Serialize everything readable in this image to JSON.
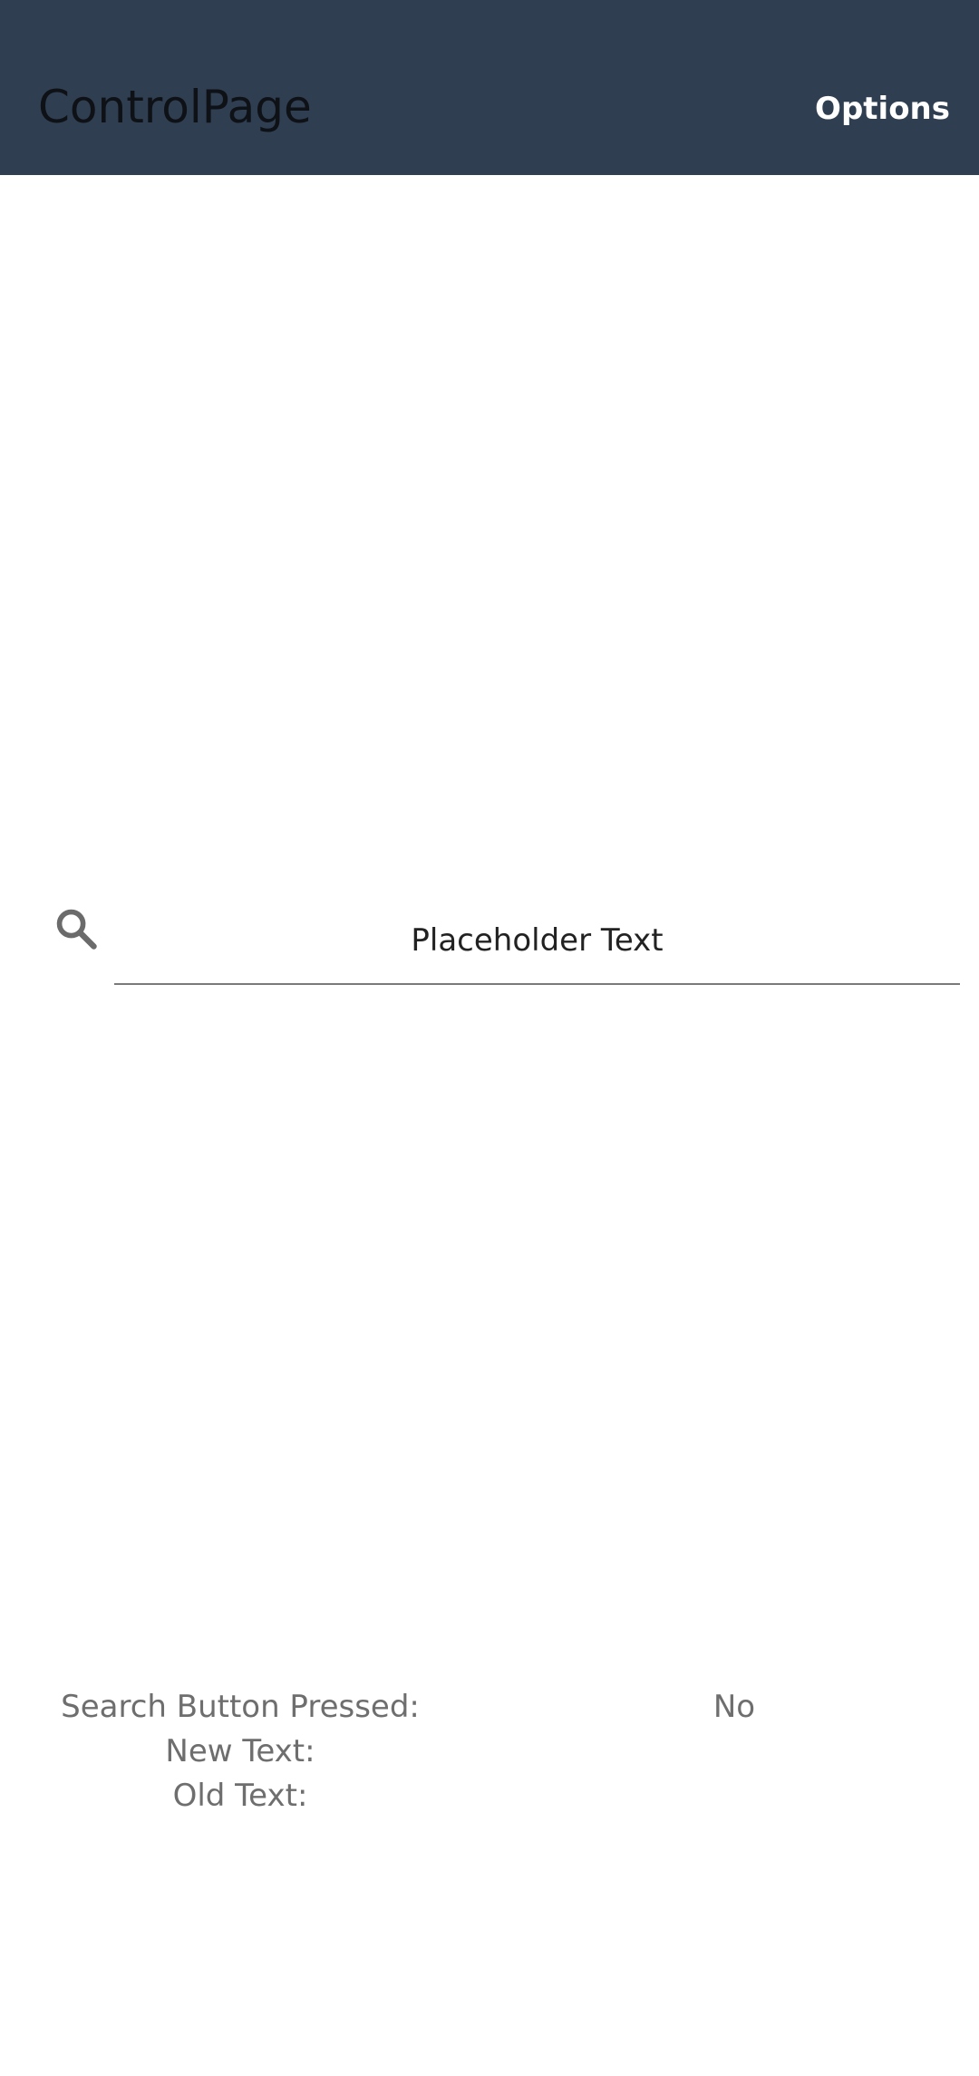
{
  "appbar": {
    "title": "ControlPage",
    "options_label": "Options",
    "background_color": "#2f3e51"
  },
  "search": {
    "icon": "search-icon",
    "placeholder": "Placeholder Text",
    "value": ""
  },
  "status": {
    "search_button_pressed_label": "Search Button Pressed:",
    "search_button_pressed_value": "No",
    "new_text_label": "New Text:",
    "new_text_value": "",
    "old_text_label": "Old Text:",
    "old_text_value": ""
  }
}
